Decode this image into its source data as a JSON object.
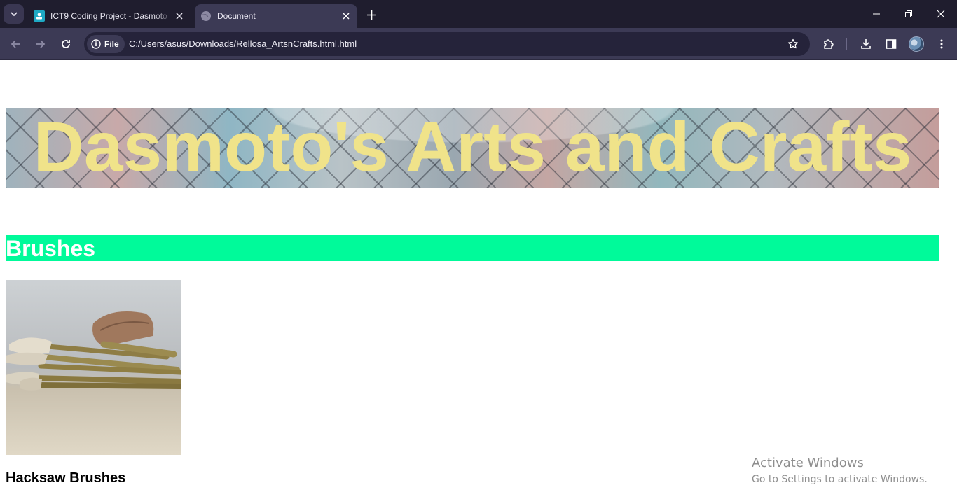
{
  "browser": {
    "tabs": [
      {
        "title": "ICT9 Coding Project - Dasmoto",
        "active": false
      },
      {
        "title": "Document",
        "active": true
      }
    ],
    "omnibox": {
      "chip_label": "File",
      "url": "C:/Users/asus/Downloads/Rellosa_ArtsnCrafts.html.html"
    },
    "colors": {
      "frame": "#1f1d2e",
      "toolbar": "#3c3a55",
      "omnibox": "#25233a"
    }
  },
  "page": {
    "banner_title": "Dasmoto's Arts and Crafts",
    "section_title": "Brushes",
    "product_name": "Hacksaw Brushes",
    "colors": {
      "banner_text": "#f0e38a",
      "section_bar": "#00fa9a",
      "section_text": "#ffffff"
    }
  },
  "watermark": {
    "line1": "Activate Windows",
    "line2": "Go to Settings to activate Windows."
  }
}
